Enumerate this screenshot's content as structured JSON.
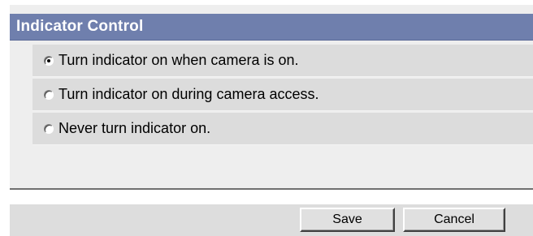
{
  "panel": {
    "title": "Indicator Control"
  },
  "options": [
    {
      "label": "Turn indicator on when camera is on.",
      "selected": true
    },
    {
      "label": "Turn indicator on during camera access.",
      "selected": false
    },
    {
      "label": "Never turn indicator on.",
      "selected": false
    }
  ],
  "footer": {
    "save_label": "Save",
    "cancel_label": "Cancel"
  },
  "colors": {
    "header_bg": "#6f7fad",
    "header_text": "#ffffff",
    "row_bg": "#dcdcdc",
    "content_bg": "#eeeeee"
  }
}
